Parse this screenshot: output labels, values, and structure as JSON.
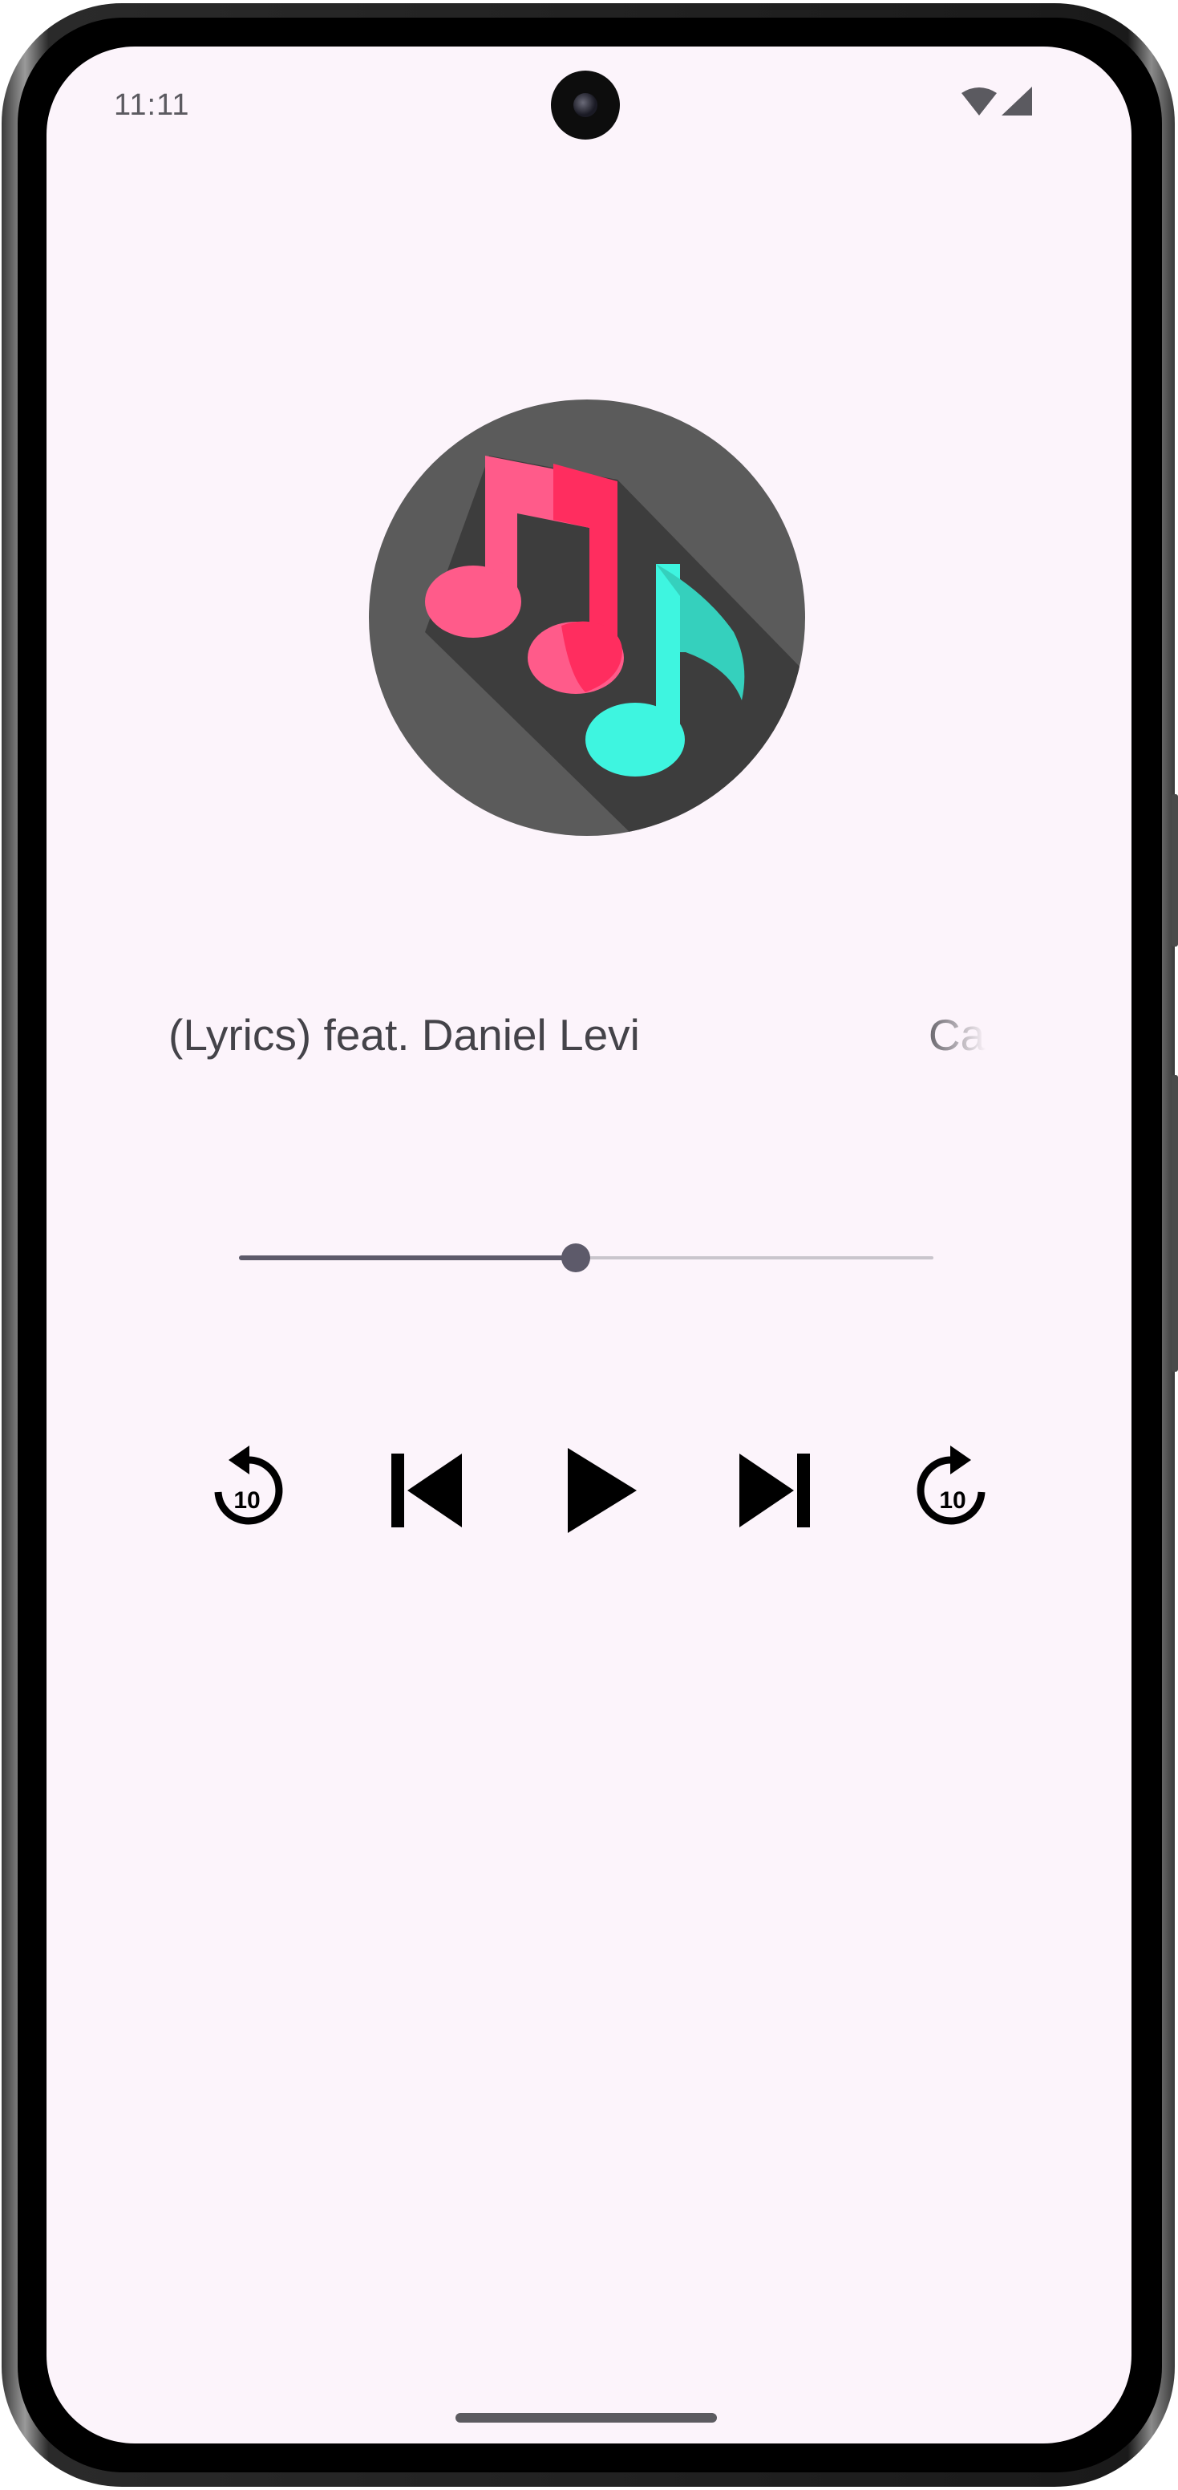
{
  "status_bar": {
    "time": "11:11"
  },
  "player": {
    "marquee_title": "(Lyrics) feat. Daniel Levi",
    "marquee_title_next": "Ca",
    "progress_fraction": 0.485,
    "controls": {
      "rewind_seconds": "10",
      "forward_seconds": "10"
    }
  },
  "colors": {
    "screen_bg": "#fcf4fb",
    "art_circle": "#5b5b5b",
    "note_pink": "#ff2d5f",
    "note_cyan": "#3ef5e0",
    "slider_active": "#5d5a6a",
    "slider_inactive": "#c9c5cc"
  },
  "icons": [
    "music-notes-icon",
    "replay-10-icon",
    "skip-previous-icon",
    "play-icon",
    "skip-next-icon",
    "forward-10-icon",
    "wifi-icon",
    "cell-signal-icon"
  ]
}
